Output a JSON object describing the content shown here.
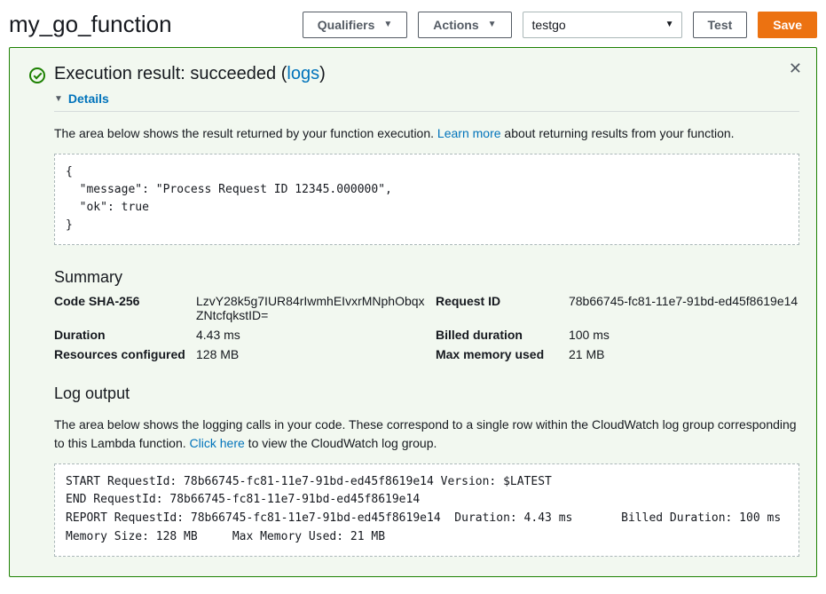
{
  "header": {
    "function_name": "my_go_function",
    "qualifiers_label": "Qualifiers",
    "actions_label": "Actions",
    "test_event_selected": "testgo",
    "test_label": "Test",
    "save_label": "Save"
  },
  "result": {
    "title_prefix": "Execution result: ",
    "status_word": "succeeded",
    "logs_link_label": "logs",
    "details_label": "Details",
    "result_intro_before": "The area below shows the result returned by your function execution. ",
    "learn_more_label": "Learn more",
    "result_intro_after": " about returning results from your function.",
    "response_json": "{\n  \"message\": \"Process Request ID 12345.000000\",\n  \"ok\": true\n}"
  },
  "summary": {
    "heading": "Summary",
    "rows": {
      "code_sha_label": "Code SHA-256",
      "code_sha_value": "LzvY28k5g7IUR84rIwmhEIvxrMNphObqxZNtcfqkstID=",
      "request_id_label": "Request ID",
      "request_id_value": "78b66745-fc81-11e7-91bd-ed45f8619e14",
      "duration_label": "Duration",
      "duration_value": "4.43 ms",
      "billed_duration_label": "Billed duration",
      "billed_duration_value": "100 ms",
      "resources_label": "Resources configured",
      "resources_value": "128 MB",
      "max_mem_label": "Max memory used",
      "max_mem_value": "21 MB"
    }
  },
  "logs": {
    "heading": "Log output",
    "intro_before": "The area below shows the logging calls in your code. These correspond to a single row within the CloudWatch log group corresponding to this Lambda function. ",
    "click_here_label": "Click here",
    "intro_after": " to view the CloudWatch log group.",
    "output": "START RequestId: 78b66745-fc81-11e7-91bd-ed45f8619e14 Version: $LATEST\nEND RequestId: 78b66745-fc81-11e7-91bd-ed45f8619e14\nREPORT RequestId: 78b66745-fc81-11e7-91bd-ed45f8619e14  Duration: 4.43 ms       Billed Duration: 100 ms \nMemory Size: 128 MB     Max Memory Used: 21 MB"
  }
}
